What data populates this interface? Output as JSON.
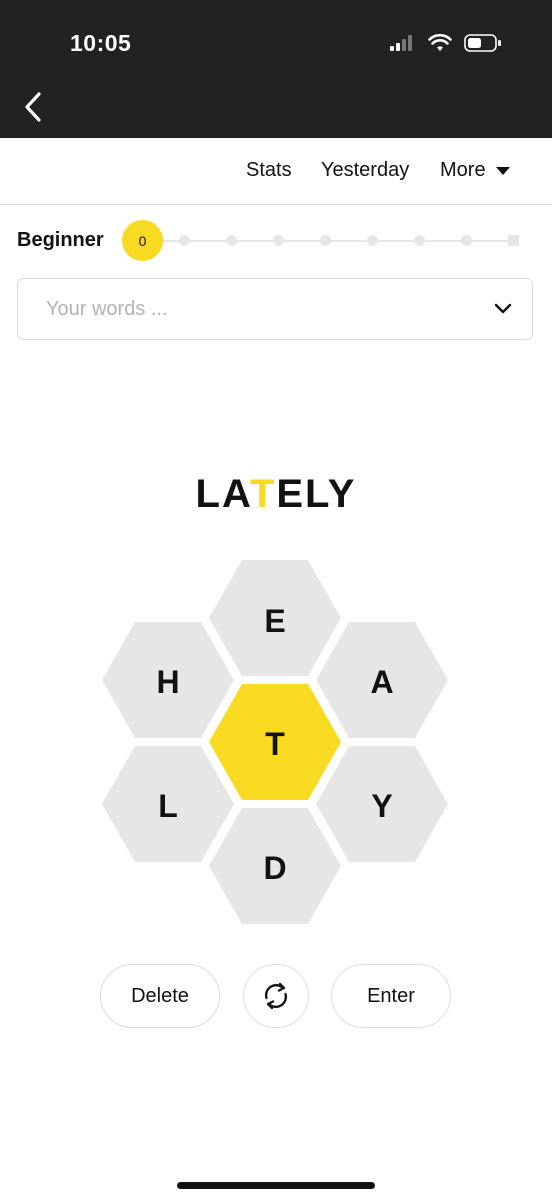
{
  "status_bar": {
    "time": "10:05"
  },
  "nav": {
    "stats": "Stats",
    "yesterday": "Yesterday",
    "more": "More"
  },
  "progress": {
    "rank": "Beginner",
    "score": "0",
    "levels": 9,
    "current_level": 0
  },
  "word_list": {
    "placeholder": "Your words ..."
  },
  "input": {
    "before": "LA",
    "center": "T",
    "after": "ELY"
  },
  "hive": {
    "center": "T",
    "outer": {
      "top": "E",
      "upper_left": "H",
      "upper_right": "A",
      "lower_left": "L",
      "lower_right": "Y",
      "bottom": "D"
    }
  },
  "controls": {
    "delete": "Delete",
    "enter": "Enter",
    "shuffle_icon": "shuffle-icon"
  },
  "colors": {
    "accent": "#f7da21",
    "cell": "#e6e6e6",
    "dark_bar": "#222222"
  }
}
